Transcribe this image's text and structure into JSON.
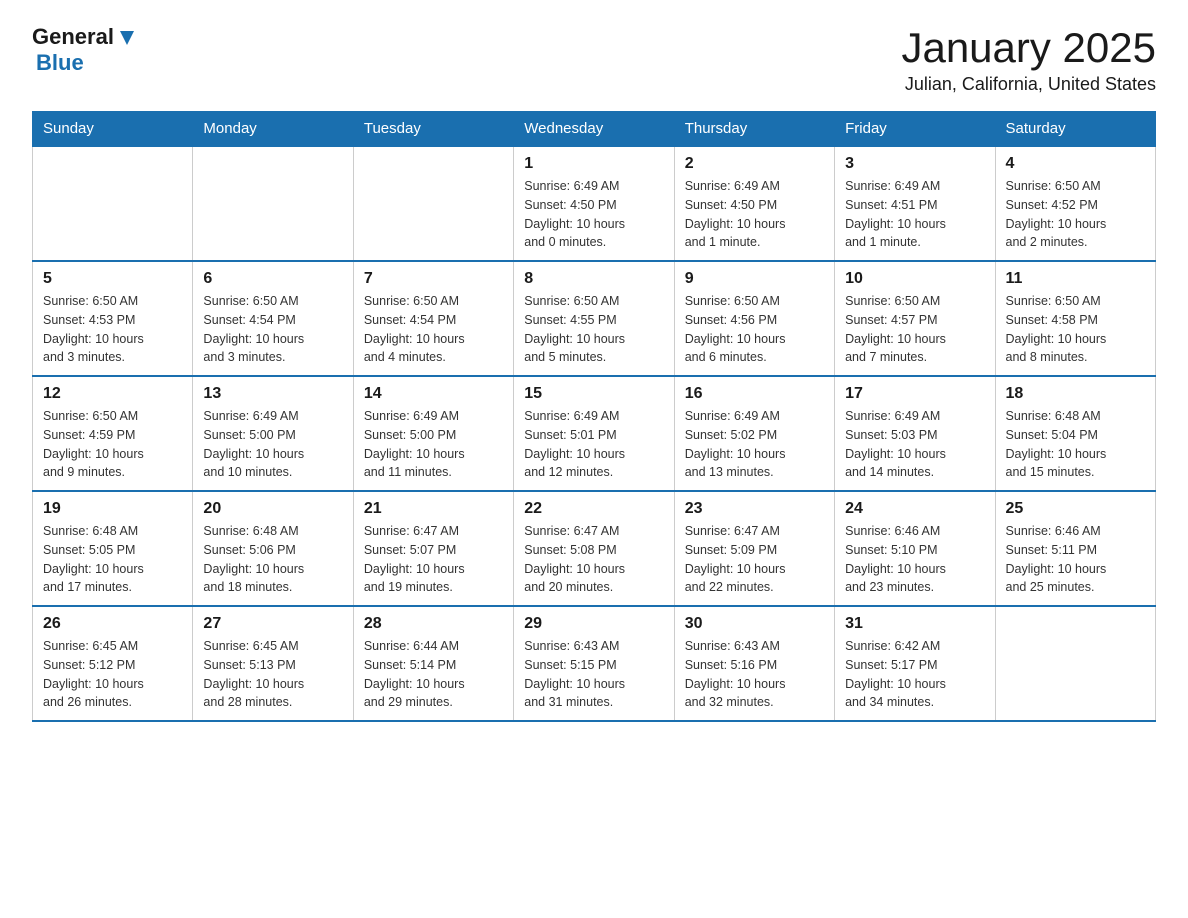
{
  "header": {
    "logo": {
      "general": "General",
      "blue": "Blue",
      "icon": "▶"
    },
    "title": "January 2025",
    "subtitle": "Julian, California, United States"
  },
  "weekdays": [
    "Sunday",
    "Monday",
    "Tuesday",
    "Wednesday",
    "Thursday",
    "Friday",
    "Saturday"
  ],
  "weeks": [
    [
      {
        "day": "",
        "info": ""
      },
      {
        "day": "",
        "info": ""
      },
      {
        "day": "",
        "info": ""
      },
      {
        "day": "1",
        "info": "Sunrise: 6:49 AM\nSunset: 4:50 PM\nDaylight: 10 hours\nand 0 minutes."
      },
      {
        "day": "2",
        "info": "Sunrise: 6:49 AM\nSunset: 4:50 PM\nDaylight: 10 hours\nand 1 minute."
      },
      {
        "day": "3",
        "info": "Sunrise: 6:49 AM\nSunset: 4:51 PM\nDaylight: 10 hours\nand 1 minute."
      },
      {
        "day": "4",
        "info": "Sunrise: 6:50 AM\nSunset: 4:52 PM\nDaylight: 10 hours\nand 2 minutes."
      }
    ],
    [
      {
        "day": "5",
        "info": "Sunrise: 6:50 AM\nSunset: 4:53 PM\nDaylight: 10 hours\nand 3 minutes."
      },
      {
        "day": "6",
        "info": "Sunrise: 6:50 AM\nSunset: 4:54 PM\nDaylight: 10 hours\nand 3 minutes."
      },
      {
        "day": "7",
        "info": "Sunrise: 6:50 AM\nSunset: 4:54 PM\nDaylight: 10 hours\nand 4 minutes."
      },
      {
        "day": "8",
        "info": "Sunrise: 6:50 AM\nSunset: 4:55 PM\nDaylight: 10 hours\nand 5 minutes."
      },
      {
        "day": "9",
        "info": "Sunrise: 6:50 AM\nSunset: 4:56 PM\nDaylight: 10 hours\nand 6 minutes."
      },
      {
        "day": "10",
        "info": "Sunrise: 6:50 AM\nSunset: 4:57 PM\nDaylight: 10 hours\nand 7 minutes."
      },
      {
        "day": "11",
        "info": "Sunrise: 6:50 AM\nSunset: 4:58 PM\nDaylight: 10 hours\nand 8 minutes."
      }
    ],
    [
      {
        "day": "12",
        "info": "Sunrise: 6:50 AM\nSunset: 4:59 PM\nDaylight: 10 hours\nand 9 minutes."
      },
      {
        "day": "13",
        "info": "Sunrise: 6:49 AM\nSunset: 5:00 PM\nDaylight: 10 hours\nand 10 minutes."
      },
      {
        "day": "14",
        "info": "Sunrise: 6:49 AM\nSunset: 5:00 PM\nDaylight: 10 hours\nand 11 minutes."
      },
      {
        "day": "15",
        "info": "Sunrise: 6:49 AM\nSunset: 5:01 PM\nDaylight: 10 hours\nand 12 minutes."
      },
      {
        "day": "16",
        "info": "Sunrise: 6:49 AM\nSunset: 5:02 PM\nDaylight: 10 hours\nand 13 minutes."
      },
      {
        "day": "17",
        "info": "Sunrise: 6:49 AM\nSunset: 5:03 PM\nDaylight: 10 hours\nand 14 minutes."
      },
      {
        "day": "18",
        "info": "Sunrise: 6:48 AM\nSunset: 5:04 PM\nDaylight: 10 hours\nand 15 minutes."
      }
    ],
    [
      {
        "day": "19",
        "info": "Sunrise: 6:48 AM\nSunset: 5:05 PM\nDaylight: 10 hours\nand 17 minutes."
      },
      {
        "day": "20",
        "info": "Sunrise: 6:48 AM\nSunset: 5:06 PM\nDaylight: 10 hours\nand 18 minutes."
      },
      {
        "day": "21",
        "info": "Sunrise: 6:47 AM\nSunset: 5:07 PM\nDaylight: 10 hours\nand 19 minutes."
      },
      {
        "day": "22",
        "info": "Sunrise: 6:47 AM\nSunset: 5:08 PM\nDaylight: 10 hours\nand 20 minutes."
      },
      {
        "day": "23",
        "info": "Sunrise: 6:47 AM\nSunset: 5:09 PM\nDaylight: 10 hours\nand 22 minutes."
      },
      {
        "day": "24",
        "info": "Sunrise: 6:46 AM\nSunset: 5:10 PM\nDaylight: 10 hours\nand 23 minutes."
      },
      {
        "day": "25",
        "info": "Sunrise: 6:46 AM\nSunset: 5:11 PM\nDaylight: 10 hours\nand 25 minutes."
      }
    ],
    [
      {
        "day": "26",
        "info": "Sunrise: 6:45 AM\nSunset: 5:12 PM\nDaylight: 10 hours\nand 26 minutes."
      },
      {
        "day": "27",
        "info": "Sunrise: 6:45 AM\nSunset: 5:13 PM\nDaylight: 10 hours\nand 28 minutes."
      },
      {
        "day": "28",
        "info": "Sunrise: 6:44 AM\nSunset: 5:14 PM\nDaylight: 10 hours\nand 29 minutes."
      },
      {
        "day": "29",
        "info": "Sunrise: 6:43 AM\nSunset: 5:15 PM\nDaylight: 10 hours\nand 31 minutes."
      },
      {
        "day": "30",
        "info": "Sunrise: 6:43 AM\nSunset: 5:16 PM\nDaylight: 10 hours\nand 32 minutes."
      },
      {
        "day": "31",
        "info": "Sunrise: 6:42 AM\nSunset: 5:17 PM\nDaylight: 10 hours\nand 34 minutes."
      },
      {
        "day": "",
        "info": ""
      }
    ]
  ]
}
